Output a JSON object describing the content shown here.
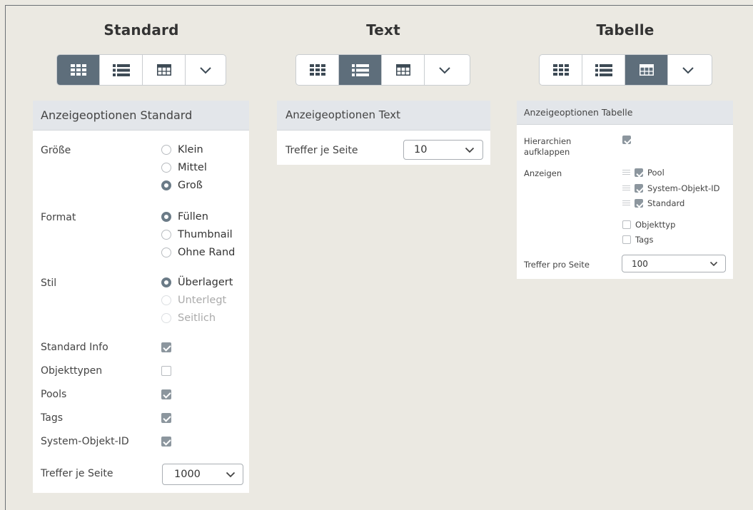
{
  "standard": {
    "title": "Standard",
    "panel_title": "Anzeigeoptionen Standard",
    "size_label": "Größe",
    "size_options": [
      "Klein",
      "Mittel",
      "Groß"
    ],
    "format_label": "Format",
    "format_options": [
      "Füllen",
      "Thumbnail",
      "Ohne Rand"
    ],
    "style_label": "Stil",
    "style_options": [
      "Überlagert",
      "Unterlegt",
      "Seitlich"
    ],
    "checks": [
      {
        "label": "Standard Info",
        "checked": true
      },
      {
        "label": "Objekttypen",
        "checked": false
      },
      {
        "label": "Pools",
        "checked": true
      },
      {
        "label": "Tags",
        "checked": true
      },
      {
        "label": "System-Objekt-ID",
        "checked": true
      }
    ],
    "per_page_label": "Treffer je Seite",
    "per_page_value": "1000"
  },
  "text": {
    "title": "Text",
    "panel_title": "Anzeigeoptionen Text",
    "per_page_label": "Treffer je Seite",
    "per_page_value": "10"
  },
  "table": {
    "title": "Tabelle",
    "panel_title": "Anzeigeoptionen Tabelle",
    "hierarchy_label": "Hierarchien aufklappen",
    "show_label": "Anzeigen",
    "columns_shown": [
      "Pool",
      "System-Objekt-ID",
      "Standard"
    ],
    "columns_hidden": [
      "Objekttyp",
      "Tags"
    ],
    "per_page_label": "Treffer pro Seite",
    "per_page_value": "100"
  },
  "colors": {
    "active_button": "#5e6e7b",
    "background": "#ebe9e2",
    "panel_header": "#e3e6ea"
  }
}
